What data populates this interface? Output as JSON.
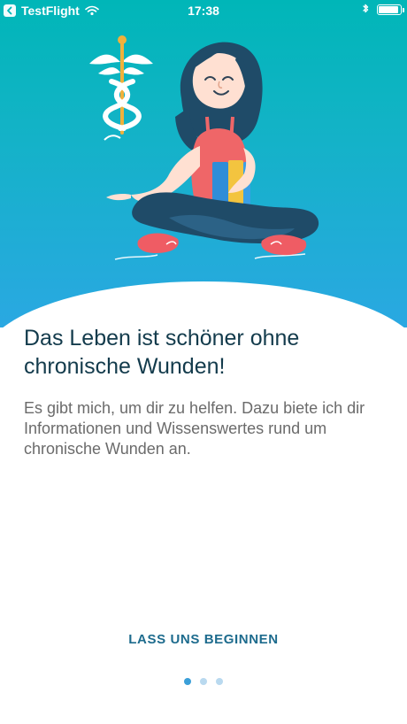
{
  "status_bar": {
    "carrier": "TestFlight",
    "time": "17:38",
    "icons": [
      "back-chip-icon",
      "wifi-icon",
      "bluetooth-icon",
      "battery-icon"
    ]
  },
  "hero": {
    "illustration": "woman-with-caduceus-and-books",
    "colors": {
      "gradient_top": "#00b6b8",
      "gradient_bottom": "#2aa8e2"
    }
  },
  "content": {
    "headline": "Das Leben ist schöner ohne chronische Wunden!",
    "body": "Es gibt mich, um dir zu helfen. Dazu biete ich dir Informationen und Wissenswertes rund um chronische Wunden an."
  },
  "cta": {
    "label": "LASS UNS BEGINNEN"
  },
  "pager": {
    "count": 3,
    "active_index": 0
  },
  "colors": {
    "headline": "#133b4c",
    "body": "#6b6b6b",
    "cta": "#1d6b8d",
    "dot_active": "#3b9fd8",
    "dot_inactive": "#b9d9ef"
  }
}
